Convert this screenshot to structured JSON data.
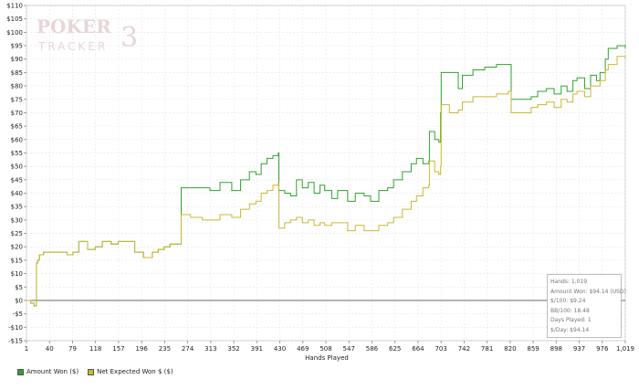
{
  "logo": {
    "line1": "POKER",
    "line2": "TRACKER",
    "mark": "3"
  },
  "chart_data": {
    "type": "line",
    "xlabel": "Hands Played",
    "ylabel": "",
    "xlim": [
      1,
      1019
    ],
    "ylim": [
      -15,
      110
    ],
    "x_ticks": [
      "1",
      "40",
      "79",
      "118",
      "157",
      "196",
      "235",
      "274",
      "313",
      "352",
      "391",
      "430",
      "469",
      "508",
      "547",
      "586",
      "625",
      "664",
      "703",
      "742",
      "781",
      "820",
      "859",
      "898",
      "937",
      "976",
      "1,019"
    ],
    "y_ticks": [
      "-$15",
      "-$10",
      "-$5",
      "$0",
      "$5",
      "$10",
      "$15",
      "$20",
      "$25",
      "$30",
      "$35",
      "$40",
      "$45",
      "$50",
      "$55",
      "$60",
      "$65",
      "$70",
      "$75",
      "$80",
      "$85",
      "$90",
      "$95",
      "$100",
      "$105",
      "$110"
    ],
    "grid": true,
    "series": [
      {
        "name": "Amount Won ($)",
        "color": "#2ea32e",
        "x": [
          1,
          8,
          14,
          18,
          20,
          23,
          30,
          50,
          70,
          80,
          90,
          105,
          118,
          130,
          145,
          157,
          170,
          185,
          200,
          215,
          225,
          235,
          245,
          262,
          264,
          280,
          300,
          313,
          330,
          350,
          365,
          380,
          391,
          400,
          410,
          420,
          429,
          430,
          440,
          450,
          460,
          470,
          480,
          490,
          500,
          508,
          520,
          530,
          547,
          560,
          575,
          586,
          600,
          615,
          625,
          640,
          655,
          664,
          675,
          685,
          686,
          695,
          702,
          705,
          706,
          710,
          720,
          735,
          742,
          760,
          780,
          800,
          812,
          820,
          825,
          840,
          850,
          859,
          870,
          885,
          898,
          910,
          920,
          930,
          937,
          950,
          960,
          970,
          976,
          985,
          990,
          1005,
          1019
        ],
        "y": [
          0,
          -1,
          -2,
          14,
          15,
          17,
          18,
          18,
          17,
          18,
          22,
          19,
          20,
          22,
          21,
          22,
          22,
          18,
          16,
          18,
          19,
          20,
          21,
          21,
          42,
          42,
          42,
          41,
          44,
          41,
          45,
          48,
          47,
          51,
          53,
          54,
          55,
          41,
          40,
          39,
          45,
          42,
          44,
          40,
          43,
          41,
          38,
          41,
          37,
          40,
          39,
          37,
          41,
          42,
          45,
          48,
          51,
          53,
          51,
          52,
          63,
          60,
          59,
          70,
          85,
          85,
          85,
          79,
          84,
          86,
          87,
          88,
          88,
          88,
          75,
          75,
          75,
          76,
          78,
          79,
          77,
          80,
          78,
          82,
          83,
          79,
          84,
          82,
          85,
          90,
          94,
          95,
          94
        ]
      },
      {
        "name": "Net Expected Won $ ($)",
        "color": "#c9b832",
        "x": [
          1,
          8,
          14,
          18,
          20,
          23,
          30,
          50,
          70,
          80,
          90,
          105,
          118,
          130,
          145,
          157,
          170,
          185,
          200,
          215,
          225,
          235,
          245,
          262,
          264,
          280,
          300,
          313,
          330,
          350,
          365,
          380,
          391,
          400,
          410,
          420,
          429,
          430,
          440,
          450,
          460,
          470,
          480,
          490,
          500,
          508,
          520,
          530,
          547,
          560,
          575,
          586,
          600,
          615,
          625,
          640,
          655,
          664,
          675,
          685,
          686,
          695,
          702,
          705,
          706,
          710,
          720,
          735,
          742,
          760,
          780,
          800,
          812,
          820,
          825,
          840,
          850,
          859,
          870,
          885,
          898,
          910,
          920,
          930,
          937,
          950,
          960,
          970,
          976,
          985,
          990,
          1005,
          1019
        ],
        "y": [
          0,
          -1,
          -2,
          14,
          15,
          17,
          18,
          18,
          17,
          18,
          22,
          19,
          20,
          22,
          21,
          22,
          22,
          18,
          16,
          18,
          19,
          20,
          21,
          21,
          32,
          31,
          30,
          30,
          32,
          31,
          34,
          36,
          37,
          40,
          41,
          43,
          44,
          27,
          29,
          30,
          31,
          29,
          30,
          28,
          29,
          28,
          29,
          29,
          26,
          28,
          26,
          26,
          28,
          29,
          31,
          34,
          37,
          39,
          42,
          43,
          52,
          48,
          47,
          50,
          73,
          73,
          70,
          71,
          74,
          76,
          76,
          77,
          77,
          78,
          70,
          70,
          70,
          72,
          73,
          74,
          72,
          75,
          74,
          77,
          78,
          76,
          80,
          80,
          82,
          86,
          88,
          91,
          90
        ]
      }
    ],
    "legend_position": "bottom-left",
    "stats": [
      "Hands: 1,019",
      "Amount Won: $94.14 (USD)",
      "$/100: $9.24",
      "BB/100: 18.48",
      "Days Played: 1",
      "$/Day: $94.14"
    ]
  }
}
